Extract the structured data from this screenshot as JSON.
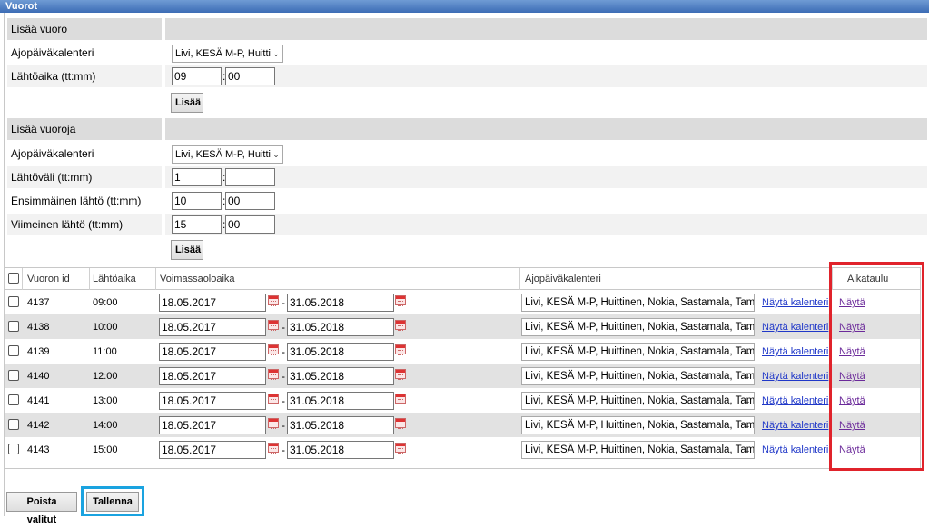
{
  "window_title": "Vuorot",
  "add_one": {
    "header": "Lisää vuoro",
    "calendar_label": "Ajopäiväkalenteri",
    "calendar_value": "Livi, KESÄ M-P, Huitti",
    "time_label": "Lähtöaika (tt:mm)",
    "hour": "09",
    "minute": "00",
    "add_button": "Lisää"
  },
  "add_many": {
    "header": "Lisää vuoroja",
    "calendar_label": "Ajopäiväkalenteri",
    "calendar_value": "Livi, KESÄ M-P, Huitti",
    "interval_label": "Lähtöväli (tt:mm)",
    "interval_hour": "1",
    "interval_minute": "",
    "first_label": "Ensimmäinen lähtö (tt:mm)",
    "first_hour": "10",
    "first_minute": "00",
    "last_label": "Viimeinen lähtö (tt:mm)",
    "last_hour": "15",
    "last_minute": "00",
    "add_button": "Lisää"
  },
  "table": {
    "columns": {
      "id": "Vuoron id",
      "time": "Lähtöaika",
      "validity": "Voimassaoloaika",
      "calendar": "Ajopäiväkalenteri",
      "schedule": "Aikataulu"
    },
    "rows": [
      {
        "id": "4137",
        "time": "09:00",
        "from": "18.05.2017",
        "to": "31.05.2018",
        "calendar": "Livi, KESÄ M-P, Huittinen, Nokia, Sastamala, Tam",
        "show_calendar": "Näytä kalenteri",
        "show": "Näytä"
      },
      {
        "id": "4138",
        "time": "10:00",
        "from": "18.05.2017",
        "to": "31.05.2018",
        "calendar": "Livi, KESÄ M-P, Huittinen, Nokia, Sastamala, Tam",
        "show_calendar": "Näytä kalenteri",
        "show": "Näytä"
      },
      {
        "id": "4139",
        "time": "11:00",
        "from": "18.05.2017",
        "to": "31.05.2018",
        "calendar": "Livi, KESÄ M-P, Huittinen, Nokia, Sastamala, Tam",
        "show_calendar": "Näytä kalenteri",
        "show": "Näytä"
      },
      {
        "id": "4140",
        "time": "12:00",
        "from": "18.05.2017",
        "to": "31.05.2018",
        "calendar": "Livi, KESÄ M-P, Huittinen, Nokia, Sastamala, Tam",
        "show_calendar": "Näytä kalenteri",
        "show": "Näytä"
      },
      {
        "id": "4141",
        "time": "13:00",
        "from": "18.05.2017",
        "to": "31.05.2018",
        "calendar": "Livi, KESÄ M-P, Huittinen, Nokia, Sastamala, Tam",
        "show_calendar": "Näytä kalenteri",
        "show": "Näytä"
      },
      {
        "id": "4142",
        "time": "14:00",
        "from": "18.05.2017",
        "to": "31.05.2018",
        "calendar": "Livi, KESÄ M-P, Huittinen, Nokia, Sastamala, Tam",
        "show_calendar": "Näytä kalenteri",
        "show": "Näytä"
      },
      {
        "id": "4143",
        "time": "15:00",
        "from": "18.05.2017",
        "to": "31.05.2018",
        "calendar": "Livi, KESÄ M-P, Huittinen, Nokia, Sastamala, Tam",
        "show_calendar": "Näytä kalenteri",
        "show": "Näytä"
      }
    ]
  },
  "footer": {
    "delete_button": "Poista valitut",
    "save_button": "Tallenna"
  },
  "colors": {
    "highlight_schedule": "#e0232b",
    "highlight_save": "#1aa3e0"
  }
}
